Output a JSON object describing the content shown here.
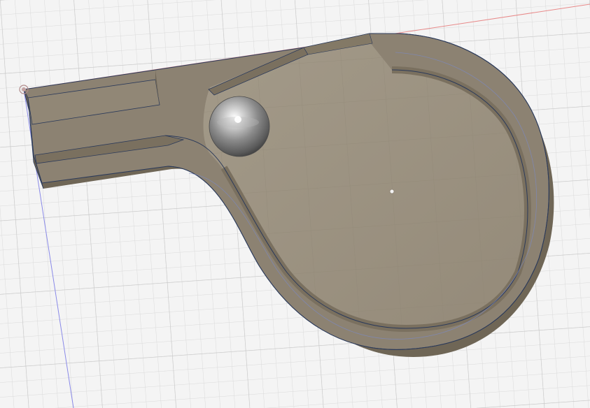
{
  "viewport": {
    "background": "#f4f4f4",
    "grid": {
      "visible": true,
      "minor_color": "#d9d9d9",
      "major_color": "#c6c6c6"
    },
    "axes": {
      "x_axis_color": "#e88a8a",
      "y_axis_color": "#8a8ae8"
    }
  },
  "model": {
    "body_name": "whistle-body",
    "body_top_color": "#8c8272",
    "body_wall_color": "#6f6656",
    "floor_color": "#9a907f",
    "edge_color": "#2b3a5a",
    "ball_color": "#9c9c9c"
  },
  "icons": {
    "origin": "origin-point-icon",
    "pivot": "center-point-icon"
  }
}
